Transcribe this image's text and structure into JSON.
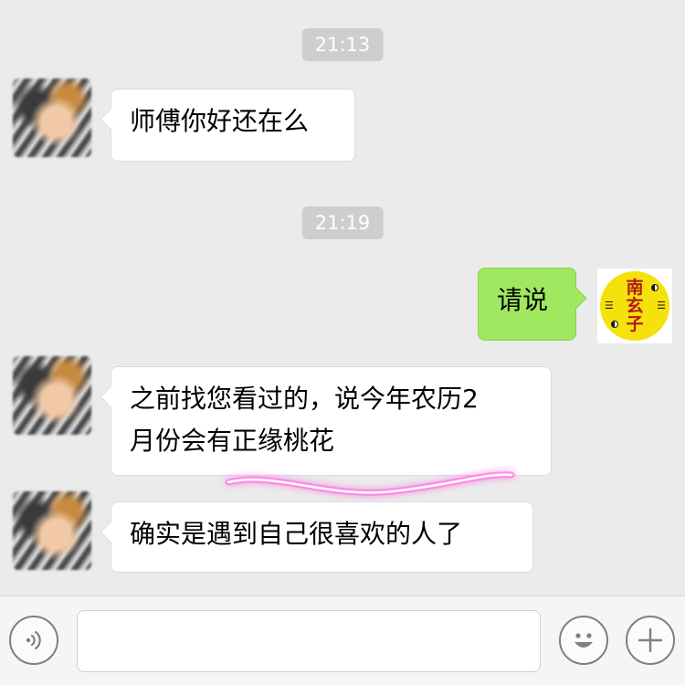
{
  "timestamps": [
    "21:13",
    "21:19"
  ],
  "messages": [
    {
      "side": "received",
      "text": "师傅你好还在么"
    },
    {
      "side": "sent",
      "text": "请说"
    },
    {
      "side": "received",
      "lines": [
        "之前找您看过的，说今年农历2",
        "月份会有正缘桃花"
      ]
    },
    {
      "side": "received",
      "text": "确实是遇到自己很喜欢的人了"
    }
  ],
  "logo": {
    "chars": [
      "南",
      "玄",
      "子"
    ],
    "trigram": "☰"
  },
  "input_bar": {
    "voice_icon": "voice-icon",
    "emoji_icon": "emoji-icon",
    "plus_icon": "plus-icon",
    "text_value": ""
  },
  "colors": {
    "background": "#ebebeb",
    "sent_bubble": "#9fe85f",
    "received_bubble": "#ffffff",
    "timestamp_bg": "#cecece",
    "highlight": "#ff6fe0"
  }
}
